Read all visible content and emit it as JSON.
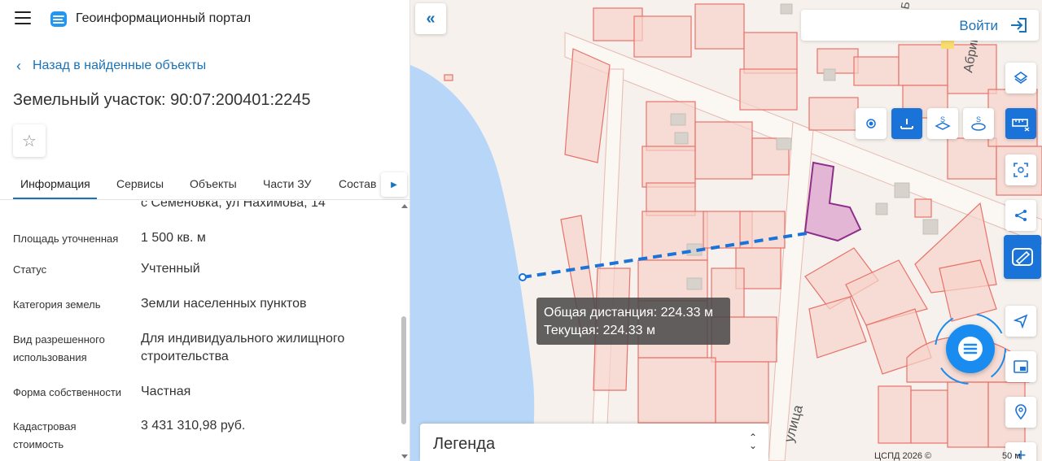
{
  "header": {
    "app_title": "Геоинформационный портал"
  },
  "nav": {
    "back_label": "Назад в найденные объекты"
  },
  "object": {
    "title": "Земельный участок: 90:07:200401:2245"
  },
  "tabs": [
    {
      "label": "Информация",
      "active": true
    },
    {
      "label": "Сервисы"
    },
    {
      "label": "Объекты"
    },
    {
      "label": "Части ЗУ"
    },
    {
      "label": "Состав"
    }
  ],
  "info": {
    "address_partial": "с Семеновка, ул Нахимова, 14",
    "rows": [
      {
        "label": "Площадь уточненная",
        "value": "1 500 кв. м"
      },
      {
        "label": "Статус",
        "value": "Учтенный"
      },
      {
        "label": "Категория земель",
        "value": "Земли населенных пунктов"
      },
      {
        "label": "Вид разрешенного использования",
        "value": "Для индивидуального жилищного строительства"
      },
      {
        "label": "Форма собственности",
        "value": "Частная"
      },
      {
        "label": "Кадастровая стоимость",
        "value": "3 431 310,98 руб."
      }
    ]
  },
  "map": {
    "login_label": "Войти",
    "tooltip": {
      "total": "Общая дистанция: 224.33 м",
      "current": "Текущая: 224.33 м"
    },
    "legend_title": "Легенда",
    "copyright": "ЦСПД 2026 ©",
    "scale": "50 м",
    "street_labels": {
      "top": "Абрик",
      "bottom": "улица"
    },
    "colors": {
      "accent": "#1a73d8",
      "parcel_line": "#e8726a",
      "water": "#b8d7f8",
      "selected": "#d98fc8"
    }
  }
}
